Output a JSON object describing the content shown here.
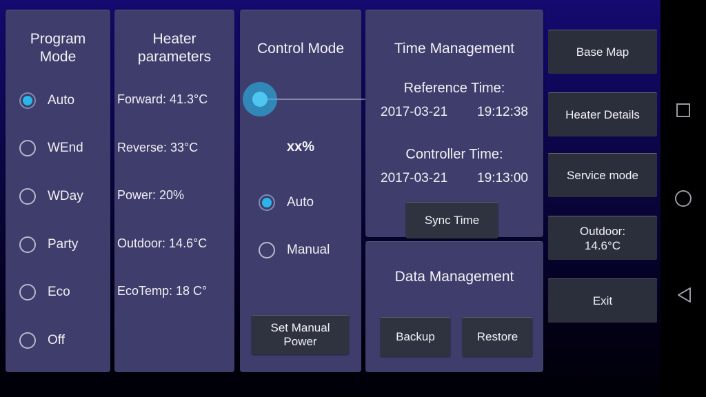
{
  "program_mode": {
    "title_line1": "Program",
    "title_line2": "Mode",
    "options": [
      {
        "label": "Auto",
        "selected": true
      },
      {
        "label": "WEnd",
        "selected": false
      },
      {
        "label": "WDay",
        "selected": false
      },
      {
        "label": "Party",
        "selected": false
      },
      {
        "label": "Eco",
        "selected": false
      },
      {
        "label": "Off",
        "selected": false
      }
    ]
  },
  "heater_parameters": {
    "title_line1": "Heater",
    "title_line2": "parameters",
    "lines": [
      "Forward: 41.3°C",
      "Reverse: 33°C",
      "Power: 20%",
      "Outdoor: 14.6°C",
      "EcoTemp: 18 C°"
    ]
  },
  "control_mode": {
    "title": "Control Mode",
    "slider_value_label": "xx%",
    "slider_position_percent": 0,
    "options": [
      {
        "label": "Auto",
        "selected": true
      },
      {
        "label": "Manual",
        "selected": false
      }
    ],
    "set_power_button_line1": "Set Manual",
    "set_power_button_line2": "Power"
  },
  "time_management": {
    "title": "Time Management",
    "reference_label": "Reference Time:",
    "reference_date": "2017-03-21",
    "reference_time": "19:12:38",
    "controller_label": "Controller Time:",
    "controller_date": "2017-03-21",
    "controller_time": "19:13:00",
    "sync_button": "Sync Time"
  },
  "data_management": {
    "title": "Data Management",
    "backup_button": "Backup",
    "restore_button": "Restore"
  },
  "sidebar": {
    "buttons": [
      {
        "label": "Base Map",
        "line1": "Base Map",
        "line2": ""
      },
      {
        "label": "Heater Details",
        "line1": "Heater Details",
        "line2": ""
      },
      {
        "label": "Service mode",
        "line1": "Service mode",
        "line2": ""
      },
      {
        "label": "Outdoor: 14.6°C",
        "line1": "Outdoor:",
        "line2": "14.6°C"
      },
      {
        "label": "Exit",
        "line1": "Exit",
        "line2": ""
      }
    ]
  },
  "navbar": {
    "recents": "recents-square-icon",
    "home": "home-circle-icon",
    "back": "back-triangle-icon"
  },
  "colors": {
    "panel": "#3f3d6b",
    "accent_cyan": "#29b6e8",
    "button_dark": "#2f3340",
    "sidebar_button": "#2b2f3c",
    "background_top": "#140a70",
    "background_bottom": "#000006",
    "text": "#f0f0f4"
  }
}
